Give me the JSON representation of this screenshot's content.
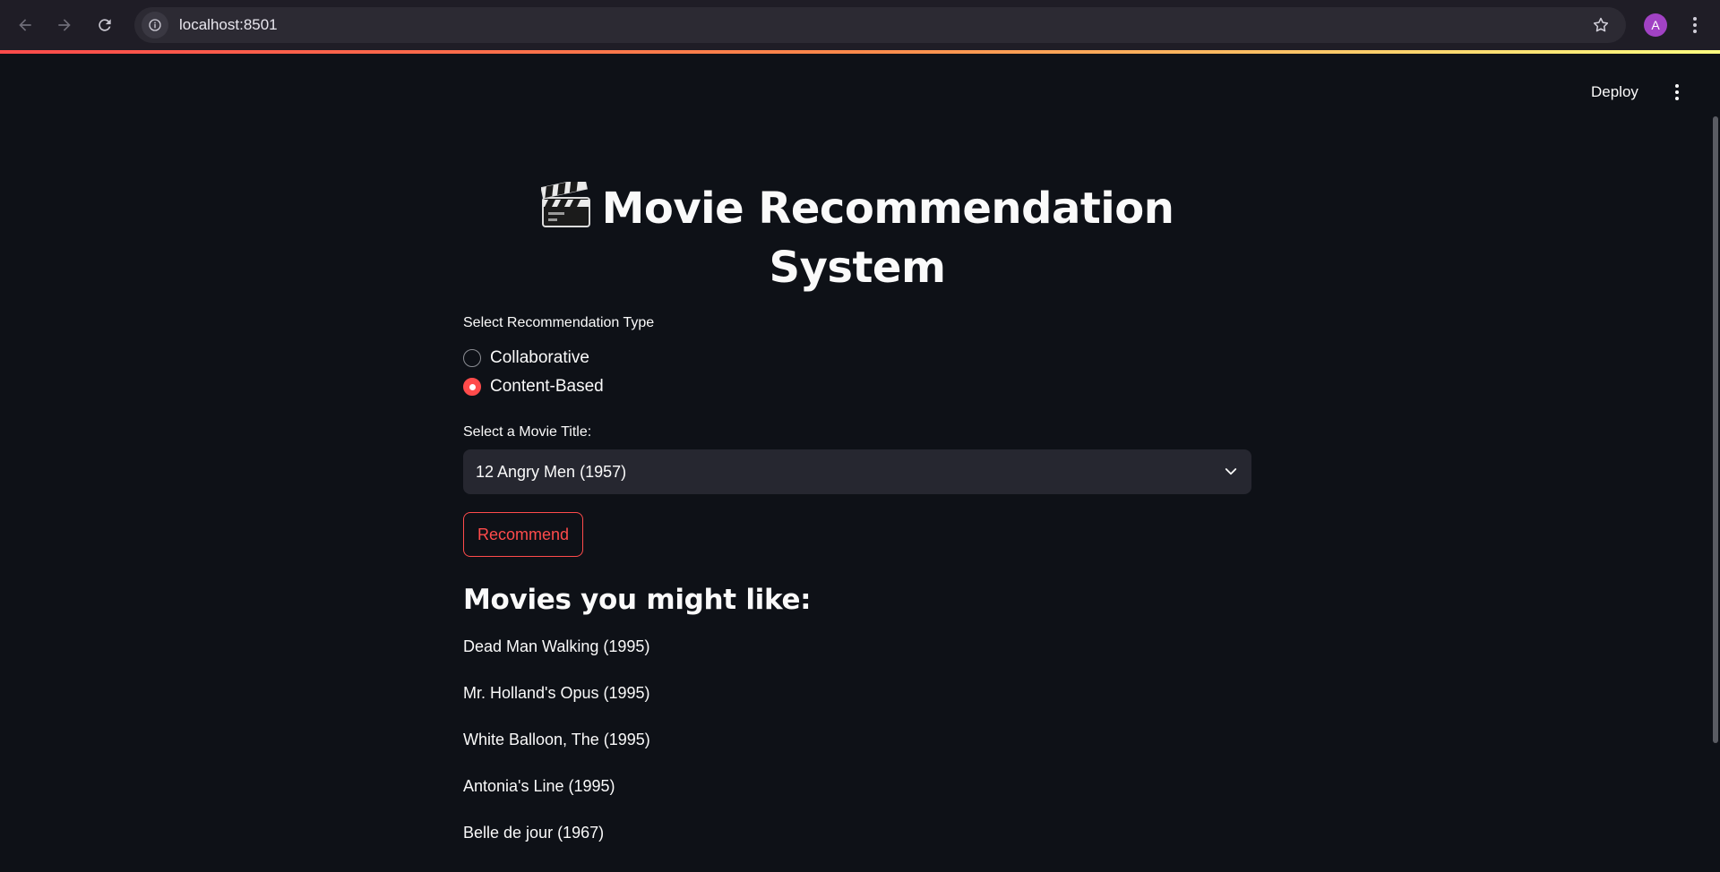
{
  "browser": {
    "url": "localhost:8501",
    "avatar_letter": "A"
  },
  "header": {
    "deploy_label": "Deploy"
  },
  "main": {
    "title_line1": "Movie Recommendation",
    "title_line2": "System",
    "title_icon": "clapper-board-icon",
    "radio_label": "Select Recommendation Type",
    "radio_options": [
      {
        "label": "Collaborative",
        "checked": false
      },
      {
        "label": "Content-Based",
        "checked": true
      }
    ],
    "select_label": "Select a Movie Title:",
    "select_value": "12 Angry Men (1957)",
    "button_label": "Recommend",
    "results_heading": "Movies you might like:",
    "results": [
      "Dead Man Walking (1995)",
      "Mr. Holland's Opus (1995)",
      "White Balloon, The (1995)",
      "Antonia's Line (1995)",
      "Belle de jour (1967)"
    ]
  },
  "colors": {
    "background": "#0e1117",
    "accent": "#ff4b4b",
    "input_bg": "#262730",
    "browser_bar": "#1f1d26"
  }
}
